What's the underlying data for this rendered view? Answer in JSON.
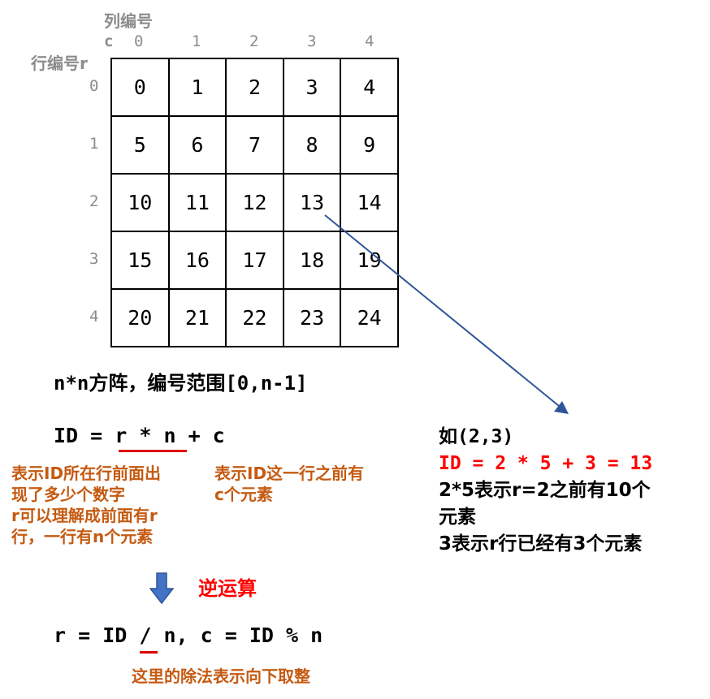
{
  "headers": {
    "col_title": "列编号",
    "row_title": "行编号r",
    "c_symbol": "c",
    "col_indices": [
      "0",
      "1",
      "2",
      "3",
      "4"
    ],
    "row_indices": [
      "0",
      "1",
      "2",
      "3",
      "4"
    ]
  },
  "grid": {
    "rows": [
      [
        "0",
        "1",
        "2",
        "3",
        "4"
      ],
      [
        "5",
        "6",
        "7",
        "8",
        "9"
      ],
      [
        "10",
        "11",
        "12",
        "13",
        "14"
      ],
      [
        "15",
        "16",
        "17",
        "18",
        "19"
      ],
      [
        "20",
        "21",
        "22",
        "23",
        "24"
      ]
    ]
  },
  "matrix_note": "n*n方阵，编号范围[0,n-1]",
  "formula": {
    "id_eq": "ID = ",
    "r_n": "r * n",
    "plus_c": " + c"
  },
  "notes": {
    "rn_explain": [
      "表示ID所在行前面出",
      "现了多少个数字",
      "r可以理解成前面有r",
      "行，一行有n个元素"
    ],
    "c_explain": [
      "表示ID这一行之前有",
      "c个元素"
    ]
  },
  "inverse": {
    "label": "逆运算",
    "formula_part1": "r = ID ",
    "slash": "/",
    "formula_part2": " n, c = ID % n",
    "note": "这里的除法表示向下取整"
  },
  "example": {
    "title": "如(2,3)",
    "calc": "ID = 2 * 5 + 3 = 13",
    "line1": "2*5表示r=2之前有10个",
    "line2": "元素",
    "line3": "3表示r行已经有3个元素"
  },
  "colors": {
    "accent_red": "#ff0000",
    "note_orange": "#c55a11",
    "arrow_blue": "#2f5597",
    "down_arrow_blue": "#4472c4"
  }
}
